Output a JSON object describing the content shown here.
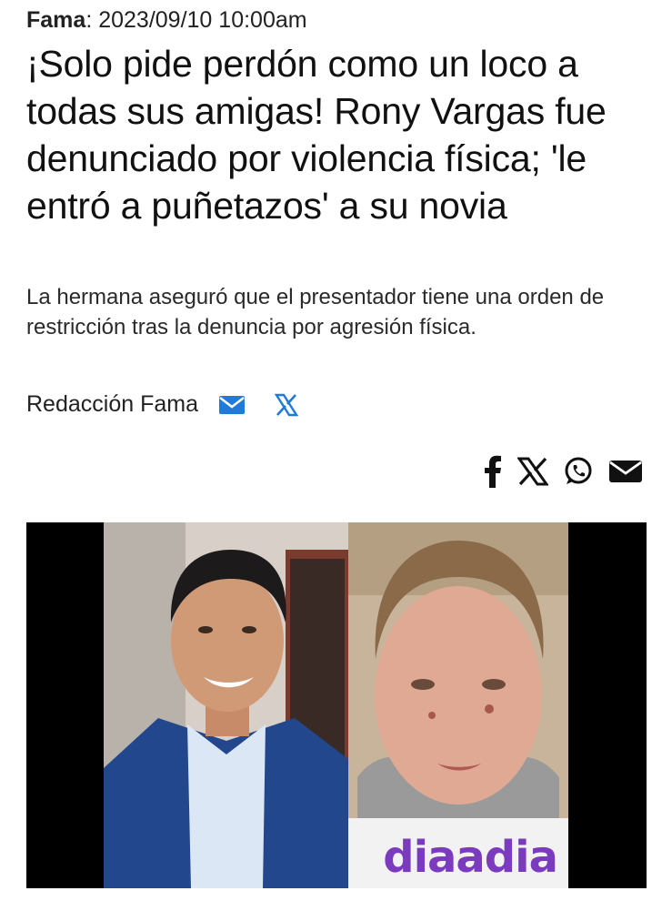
{
  "article": {
    "section": "Fama",
    "separator": ":",
    "datetime": "2023/09/10 10:00am",
    "headline": "¡Solo pide perdón como un loco a todas sus amigas! Rony Vargas fue denunciado por violencia física; 'le entró a puñetazos' a su novia",
    "summary": "La hermana aseguró que el presentador tiene una orden de restricción tras la denuncia por agresión física.",
    "author": "Redacción Fama"
  },
  "byline_icons": [
    "mail-icon",
    "x-icon"
  ],
  "share": {
    "icons": [
      "facebook-icon",
      "x-icon",
      "whatsapp-icon",
      "mail-icon"
    ]
  },
  "image": {
    "watermark": "diaadia"
  },
  "colors": {
    "byline_icon": "#1f7ad8",
    "share_icon": "#111111",
    "watermark": "#7a3bbf",
    "frame": "#000000"
  }
}
